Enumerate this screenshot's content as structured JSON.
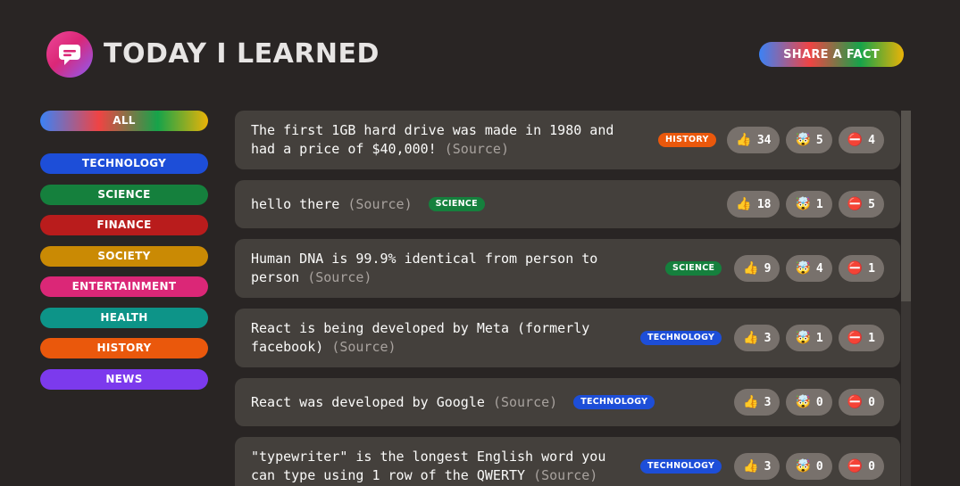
{
  "header": {
    "title": "Today I Learned",
    "share_label": "Share a fact",
    "logo_icon": "chat-bubble-icon"
  },
  "categories": [
    {
      "name": "All",
      "color": "gradient"
    },
    {
      "name": "technology",
      "color": "#1d4ed8"
    },
    {
      "name": "science",
      "color": "#15803d"
    },
    {
      "name": "finance",
      "color": "#b91c1c"
    },
    {
      "name": "society",
      "color": "#ca8a04"
    },
    {
      "name": "entertainment",
      "color": "#db2777"
    },
    {
      "name": "health",
      "color": "#0d9488"
    },
    {
      "name": "history",
      "color": "#ea580c"
    },
    {
      "name": "news",
      "color": "#7c3aed"
    }
  ],
  "facts": [
    {
      "text": "The first 1GB hard drive was made in 1980 and had a price of $40,000!",
      "source": "(Source)",
      "category": "history",
      "tag_color": "#ea580c",
      "votes": {
        "interesting": "34",
        "mindblowing": "5",
        "false": "4"
      }
    },
    {
      "text": "hello there",
      "source": "(Source)",
      "category": "science",
      "tag_color": "#15803d",
      "votes": {
        "interesting": "18",
        "mindblowing": "1",
        "false": "5"
      }
    },
    {
      "text": "Human DNA is 99.9% identical from person to person",
      "source": "(Source)",
      "category": "science",
      "tag_color": "#15803d",
      "votes": {
        "interesting": "9",
        "mindblowing": "4",
        "false": "1"
      }
    },
    {
      "text": "React is being developed by Meta (formerly facebook)",
      "source": "(Source)",
      "category": "technology",
      "tag_color": "#1d4ed8",
      "votes": {
        "interesting": "3",
        "mindblowing": "1",
        "false": "1"
      }
    },
    {
      "text": "React was developed by Google",
      "source": "(Source)",
      "category": "technology",
      "tag_color": "#1d4ed8",
      "votes": {
        "interesting": "3",
        "mindblowing": "0",
        "false": "0"
      }
    },
    {
      "text": "\"typewriter\" is the longest English word you can type using 1 row of the QWERTY",
      "source": "(Source)",
      "category": "technology",
      "tag_color": "#1d4ed8",
      "votes": {
        "interesting": "3",
        "mindblowing": "0",
        "false": "0"
      }
    }
  ]
}
